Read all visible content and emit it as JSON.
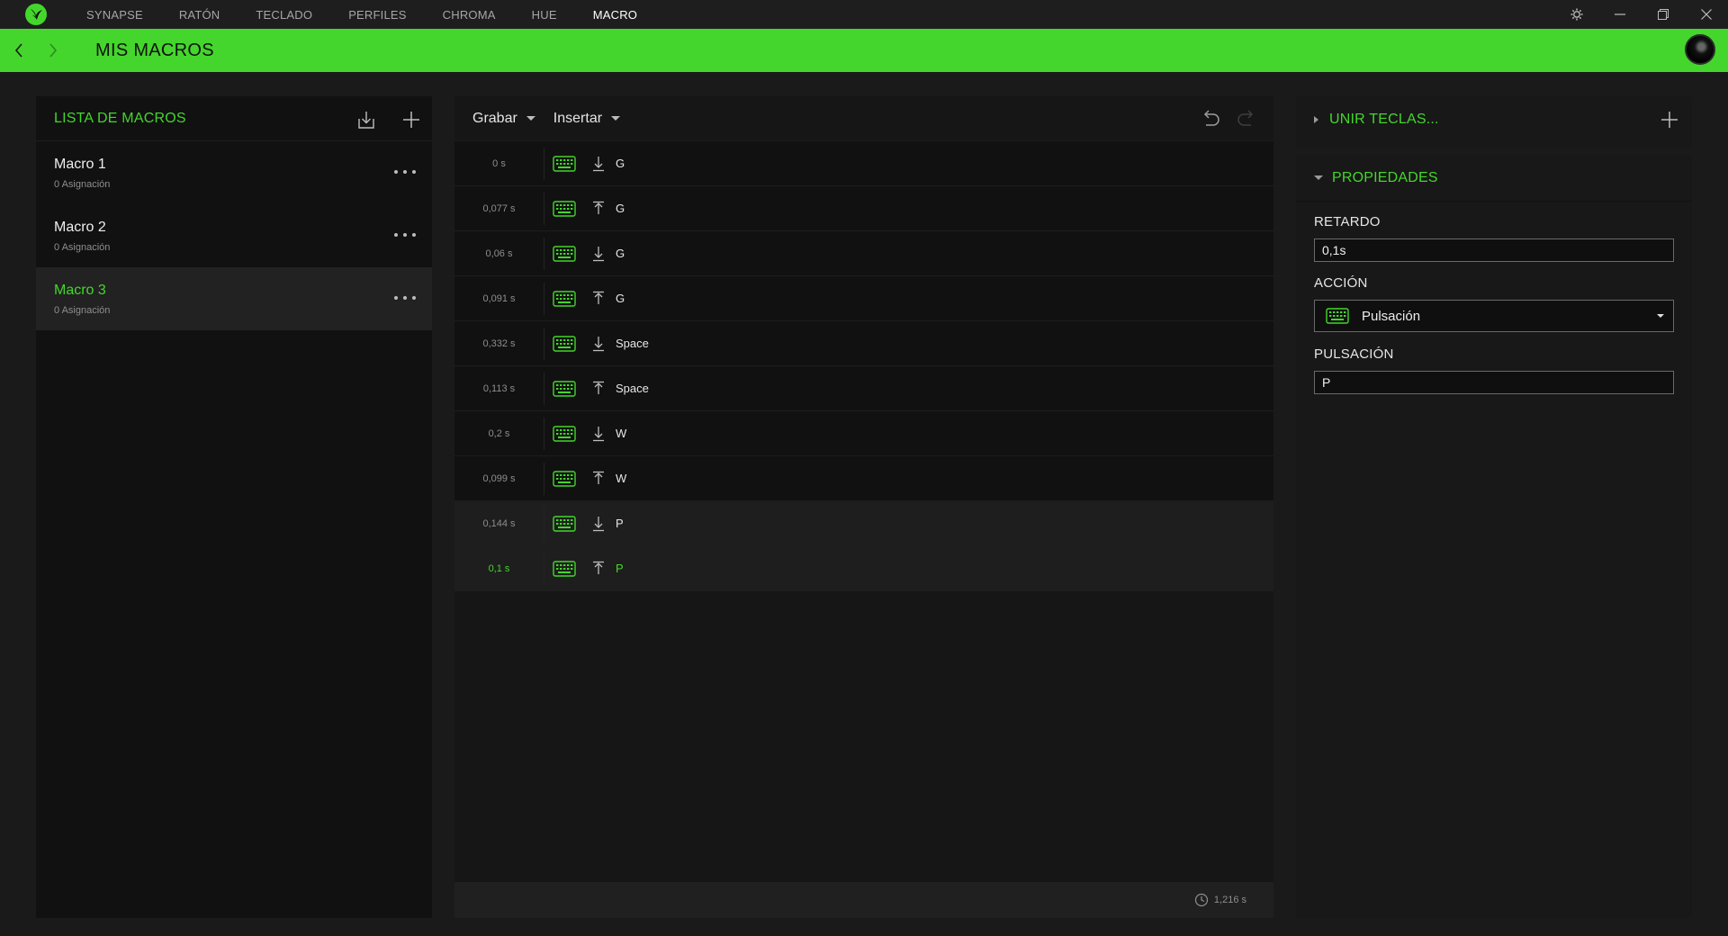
{
  "titlebar": {
    "tabs": [
      {
        "label": "SYNAPSE"
      },
      {
        "label": "RATÓN"
      },
      {
        "label": "TECLADO"
      },
      {
        "label": "PERFILES"
      },
      {
        "label": "CHROMA"
      },
      {
        "label": "HUE"
      },
      {
        "label": "MACRO"
      }
    ],
    "active_tab": "MACRO",
    "icons": [
      "razer-logo-icon",
      "settings-icon",
      "minimize-icon",
      "restore-icon",
      "close-icon"
    ]
  },
  "header": {
    "title": "MIS MACROS",
    "accent_color": "#44d62c"
  },
  "macro_list": {
    "title": "LISTA DE MACROS",
    "items": [
      {
        "name": "Macro 1",
        "sub": "0 Asignación"
      },
      {
        "name": "Macro 2",
        "sub": "0 Asignación"
      },
      {
        "name": "Macro 3",
        "sub": "0 Asignación",
        "selected": true
      }
    ]
  },
  "editor": {
    "record_label": "Grabar",
    "insert_label": "Insertar",
    "events": [
      {
        "delay": "0 s",
        "direction": "down",
        "key": "G"
      },
      {
        "delay": "0,077 s",
        "direction": "up",
        "key": "G"
      },
      {
        "delay": "0,06 s",
        "direction": "down",
        "key": "G"
      },
      {
        "delay": "0,091 s",
        "direction": "up",
        "key": "G"
      },
      {
        "delay": "0,332 s",
        "direction": "down",
        "key": "Space"
      },
      {
        "delay": "0,113 s",
        "direction": "up",
        "key": "Space"
      },
      {
        "delay": "0,2 s",
        "direction": "down",
        "key": "W"
      },
      {
        "delay": "0,099 s",
        "direction": "up",
        "key": "W"
      },
      {
        "delay": "0,144 s",
        "direction": "down",
        "key": "P"
      },
      {
        "delay": "0,1 s",
        "direction": "up",
        "key": "P",
        "selected": true
      }
    ],
    "total_time": "1,216 s"
  },
  "right": {
    "join_keys_title": "UNIR TECLAS...",
    "properties_title": "PROPIEDADES",
    "delay_label": "RETARDO",
    "delay_value": "0,1s",
    "action_label": "ACCIÓN",
    "action_value": "Pulsación",
    "keystroke_label": "PULSACIÓN",
    "keystroke_value": "P"
  }
}
